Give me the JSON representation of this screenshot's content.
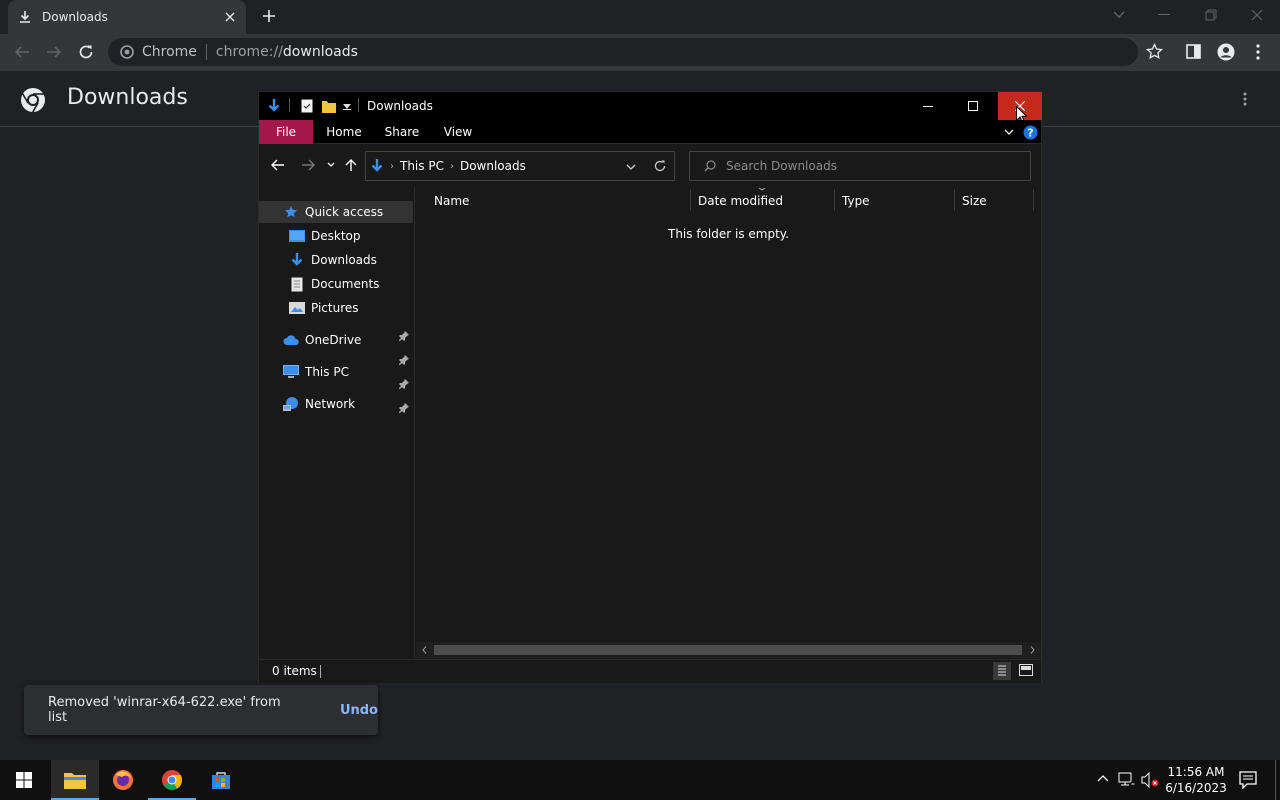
{
  "browser": {
    "tab_title": "Downloads",
    "omnibox_chip": "Chrome",
    "url_scheme": "chrome://",
    "url_host": "downloads",
    "page_title": "Downloads"
  },
  "explorer": {
    "window_title": "Downloads",
    "ribbon_tabs": {
      "file": "File",
      "home": "Home",
      "share": "Share",
      "view": "View"
    },
    "breadcrumb": {
      "this_pc": "This PC",
      "downloads": "Downloads"
    },
    "search_placeholder": "Search Downloads",
    "nav": {
      "quick_access": "Quick access",
      "desktop": "Desktop",
      "downloads": "Downloads",
      "documents": "Documents",
      "pictures": "Pictures",
      "onedrive": "OneDrive",
      "this_pc": "This PC",
      "network": "Network"
    },
    "columns": {
      "name": "Name",
      "date_modified": "Date modified",
      "type": "Type",
      "size": "Size"
    },
    "empty_message": "This folder is empty.",
    "status_items": "0 items"
  },
  "toast": {
    "message": "Removed 'winrar-x64-622.exe' from list",
    "action": "Undo"
  },
  "taskbar": {
    "time": "11:56 AM",
    "date": "6/16/2023"
  },
  "colors": {
    "file_tab": "#a4174b",
    "close_hover": "#c42b1c",
    "accent_link": "#8ab4f8",
    "folder_blue": "#3c8ee8"
  }
}
